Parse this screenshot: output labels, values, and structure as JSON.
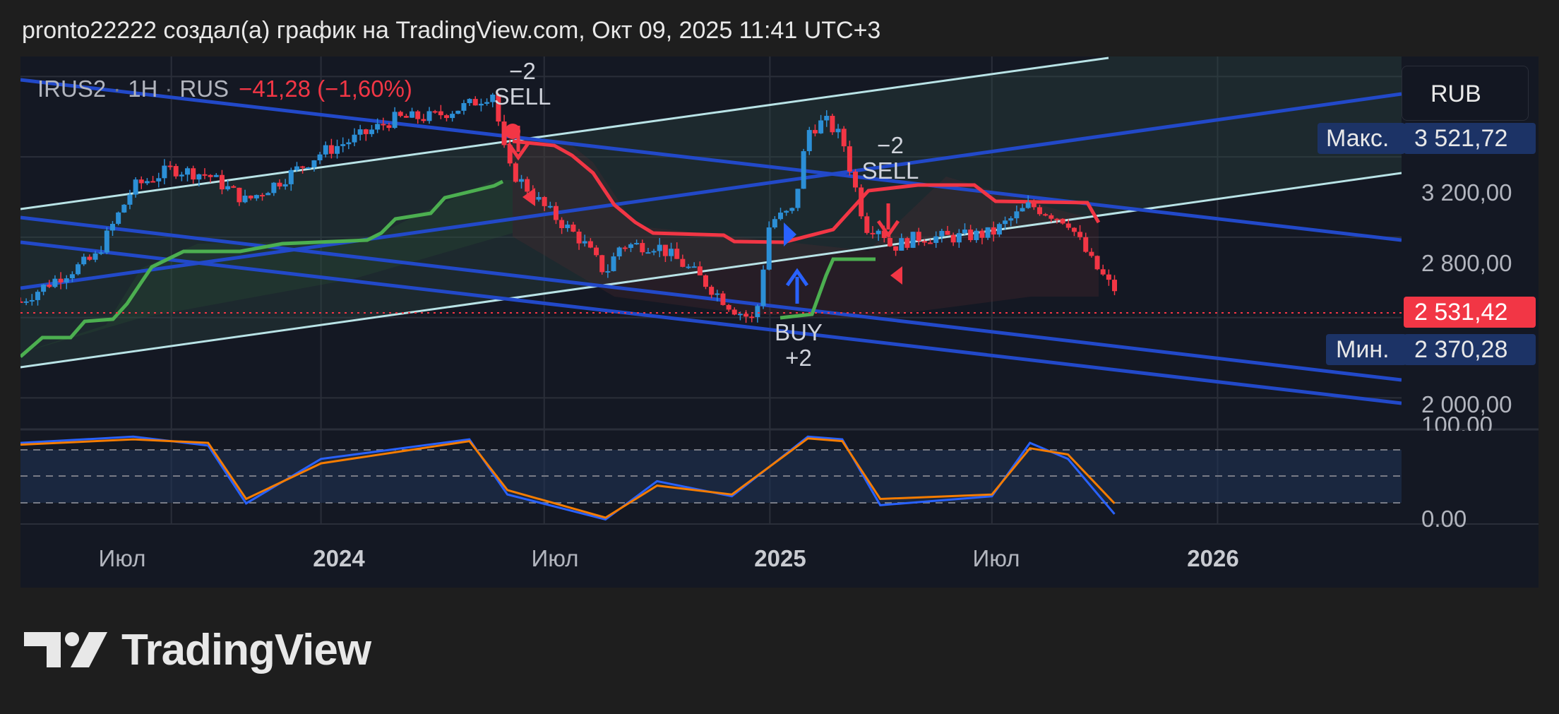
{
  "header": {
    "text": "pronto22222 создал(а) график на TradingView.com, Окт 09, 2025 11:41 UTC+3"
  },
  "legend": {
    "symbol": "IRUS2",
    "interval": "1H",
    "exchange": "RUS",
    "separator": "·",
    "change": "−41,28 (−1,60%)"
  },
  "currency": "RUB",
  "price_tags": {
    "max_label": "Макс.",
    "max_value": "3 521,72",
    "current_value": "2 531,42",
    "min_label": "Мин.",
    "min_value": "2 370,28"
  },
  "price_axis": [
    "3 200,00",
    "2 800,00",
    "2 000,00"
  ],
  "osc_axis": [
    "100,00",
    "0.00"
  ],
  "time_axis": [
    {
      "label": "Июл",
      "bold": false
    },
    {
      "label": "2024",
      "bold": true
    },
    {
      "label": "Июл",
      "bold": false
    },
    {
      "label": "2025",
      "bold": true
    },
    {
      "label": "Июл",
      "bold": false
    },
    {
      "label": "2026",
      "bold": true
    }
  ],
  "signals": [
    {
      "line1": "−2",
      "line2": "SELL"
    },
    {
      "line1": "BUY",
      "line2": "+2"
    },
    {
      "line1": "−2",
      "line2": "SELL"
    }
  ],
  "brand": {
    "logo_text": "TradingView"
  },
  "colors": {
    "background": "#1e1e1e",
    "pane": "#141823",
    "up": "#2c8fd6",
    "down": "#f23645",
    "supertrend_up": "#4caf50",
    "supertrend_down": "#f23645",
    "channel_blue": "#2249c9",
    "channel_light": "#b9e3e6",
    "stoch_k": "#2962ff",
    "stoch_d": "#f57c00"
  },
  "chart_data": {
    "type": "candlestick",
    "symbol": "IRUS2",
    "interval": "1H",
    "x_range": [
      "2023-05-01",
      "2026-05-31"
    ],
    "ylim": [
      1850,
      3700
    ],
    "price_series": [
      {
        "date": "2023-05-01",
        "close": 2480
      },
      {
        "date": "2023-06-01",
        "close": 2600
      },
      {
        "date": "2023-07-01",
        "close": 2700
      },
      {
        "date": "2023-08-01",
        "close": 3050
      },
      {
        "date": "2023-09-01",
        "close": 3140
      },
      {
        "date": "2023-10-01",
        "close": 3110
      },
      {
        "date": "2023-11-01",
        "close": 2980
      },
      {
        "date": "2023-12-01",
        "close": 3090
      },
      {
        "date": "2024-01-01",
        "close": 3220
      },
      {
        "date": "2024-02-01",
        "close": 3300
      },
      {
        "date": "2024-03-01",
        "close": 3390
      },
      {
        "date": "2024-04-01",
        "close": 3400
      },
      {
        "date": "2024-05-01",
        "close": 3460
      },
      {
        "date": "2024-05-20",
        "close": 3521
      },
      {
        "date": "2024-06-01",
        "close": 3150
      },
      {
        "date": "2024-07-01",
        "close": 2950
      },
      {
        "date": "2024-08-01",
        "close": 2780
      },
      {
        "date": "2024-08-20",
        "close": 2620
      },
      {
        "date": "2024-09-01",
        "close": 2760
      },
      {
        "date": "2024-10-01",
        "close": 2760
      },
      {
        "date": "2024-11-01",
        "close": 2620
      },
      {
        "date": "2024-12-01",
        "close": 2450
      },
      {
        "date": "2024-12-20",
        "close": 2380
      },
      {
        "date": "2025-01-01",
        "close": 2880
      },
      {
        "date": "2025-01-20",
        "close": 2930
      },
      {
        "date": "2025-02-01",
        "close": 3330
      },
      {
        "date": "2025-02-15",
        "close": 3380
      },
      {
        "date": "2025-03-01",
        "close": 3290
      },
      {
        "date": "2025-03-20",
        "close": 2850
      },
      {
        "date": "2025-04-01",
        "close": 2850
      },
      {
        "date": "2025-04-10",
        "close": 2750
      },
      {
        "date": "2025-05-01",
        "close": 2800
      },
      {
        "date": "2025-06-01",
        "close": 2800
      },
      {
        "date": "2025-07-01",
        "close": 2820
      },
      {
        "date": "2025-08-01",
        "close": 2960
      },
      {
        "date": "2025-09-01",
        "close": 2880
      },
      {
        "date": "2025-09-20",
        "close": 2680
      },
      {
        "date": "2025-10-09",
        "close": 2531.42
      }
    ],
    "current_price": 2531.42,
    "period_max": 3521.72,
    "period_min": 2370.28,
    "change": -41.28,
    "change_pct": -1.6,
    "oscillator": {
      "ylim": [
        0,
        100
      ],
      "bands": [
        20,
        50,
        80
      ],
      "k": [
        {
          "date": "2023-05-01",
          "value": 88
        },
        {
          "date": "2023-08-01",
          "value": 95
        },
        {
          "date": "2023-10-01",
          "value": 85
        },
        {
          "date": "2023-11-01",
          "value": 20
        },
        {
          "date": "2024-01-01",
          "value": 70
        },
        {
          "date": "2024-05-01",
          "value": 92
        },
        {
          "date": "2024-06-01",
          "value": 30
        },
        {
          "date": "2024-08-20",
          "value": 2
        },
        {
          "date": "2024-10-01",
          "value": 45
        },
        {
          "date": "2024-12-01",
          "value": 28
        },
        {
          "date": "2025-02-01",
          "value": 95
        },
        {
          "date": "2025-03-01",
          "value": 92
        },
        {
          "date": "2025-04-01",
          "value": 18
        },
        {
          "date": "2025-07-01",
          "value": 28
        },
        {
          "date": "2025-08-01",
          "value": 88
        },
        {
          "date": "2025-09-01",
          "value": 70
        },
        {
          "date": "2025-10-09",
          "value": 8
        }
      ],
      "d": [
        {
          "date": "2023-05-01",
          "value": 86
        },
        {
          "date": "2023-08-01",
          "value": 92
        },
        {
          "date": "2023-10-01",
          "value": 88
        },
        {
          "date": "2023-11-01",
          "value": 25
        },
        {
          "date": "2024-01-01",
          "value": 65
        },
        {
          "date": "2024-05-01",
          "value": 90
        },
        {
          "date": "2024-06-01",
          "value": 35
        },
        {
          "date": "2024-08-20",
          "value": 4
        },
        {
          "date": "2024-10-01",
          "value": 40
        },
        {
          "date": "2024-12-01",
          "value": 30
        },
        {
          "date": "2025-02-01",
          "value": 93
        },
        {
          "date": "2025-03-01",
          "value": 90
        },
        {
          "date": "2025-04-01",
          "value": 25
        },
        {
          "date": "2025-07-01",
          "value": 30
        },
        {
          "date": "2025-08-01",
          "value": 82
        },
        {
          "date": "2025-09-01",
          "value": 75
        },
        {
          "date": "2025-10-09",
          "value": 20
        }
      ]
    },
    "signals": [
      {
        "date": "2024-05-20",
        "type": "sell",
        "size": -2
      },
      {
        "date": "2025-01-10",
        "type": "buy",
        "size": 2
      },
      {
        "date": "2025-03-15",
        "type": "sell",
        "size": -2
      }
    ]
  }
}
